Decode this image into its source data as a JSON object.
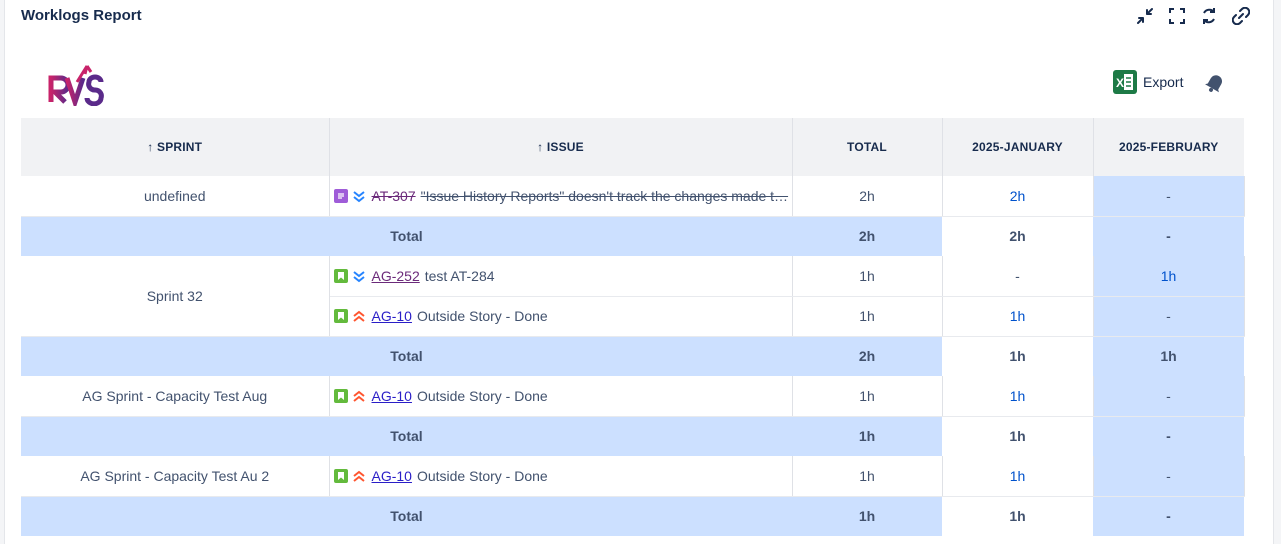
{
  "report": {
    "title": "Worklogs Report",
    "export_label": "Export"
  },
  "icons": {
    "collapse": "collapse-arrows-icon",
    "fullscreen": "fullscreen-icon",
    "refresh": "refresh-icon",
    "link": "link-icon",
    "excel": "excel-icon",
    "bell": "bell-icon"
  },
  "colors": {
    "total_row": "#cce0ff",
    "link": "#0052cc",
    "excel": "#1d7a46",
    "story": "#63ba3c",
    "task": "#9f5cd8"
  },
  "table": {
    "headers": {
      "sprint": "↑ SPRINT",
      "issue": "↑ ISSUE",
      "total": "TOTAL",
      "jan": "2025-JANUARY",
      "feb": "2025-FEBRUARY"
    },
    "rows": [
      {
        "sprint": "undefined",
        "type": "task",
        "priority": "low",
        "key": "AT-307",
        "summary": "\"Issue History Reports\" doesn't track the changes made t…",
        "total": "2h",
        "jan": "2h",
        "feb": "-"
      },
      {
        "total_label": "Total",
        "total": "2h",
        "jan": "2h",
        "feb": "-"
      },
      {
        "sprint": "Sprint 32",
        "type": "story",
        "priority": "low",
        "key": "AG-252",
        "summary": "test AT-284",
        "total": "1h",
        "jan": "-",
        "feb": "1h"
      },
      {
        "type": "story",
        "priority": "high",
        "key": "AG-10",
        "summary": "Outside Story - Done",
        "total": "1h",
        "jan": "1h",
        "feb": "-"
      },
      {
        "total_label": "Total",
        "total": "2h",
        "jan": "1h",
        "feb": "1h"
      },
      {
        "sprint": "AG Sprint - Capacity Test Aug",
        "type": "story",
        "priority": "high",
        "key": "AG-10",
        "summary": "Outside Story - Done",
        "total": "1h",
        "jan": "1h",
        "feb": "-"
      },
      {
        "total_label": "Total",
        "total": "1h",
        "jan": "1h",
        "feb": "-"
      },
      {
        "sprint": "AG Sprint - Capacity Test Au 2",
        "type": "story",
        "priority": "high",
        "key": "AG-10",
        "summary": "Outside Story - Done",
        "total": "1h",
        "jan": "1h",
        "feb": "-"
      },
      {
        "total_label": "Total",
        "total": "1h",
        "jan": "1h",
        "feb": "-"
      }
    ]
  }
}
